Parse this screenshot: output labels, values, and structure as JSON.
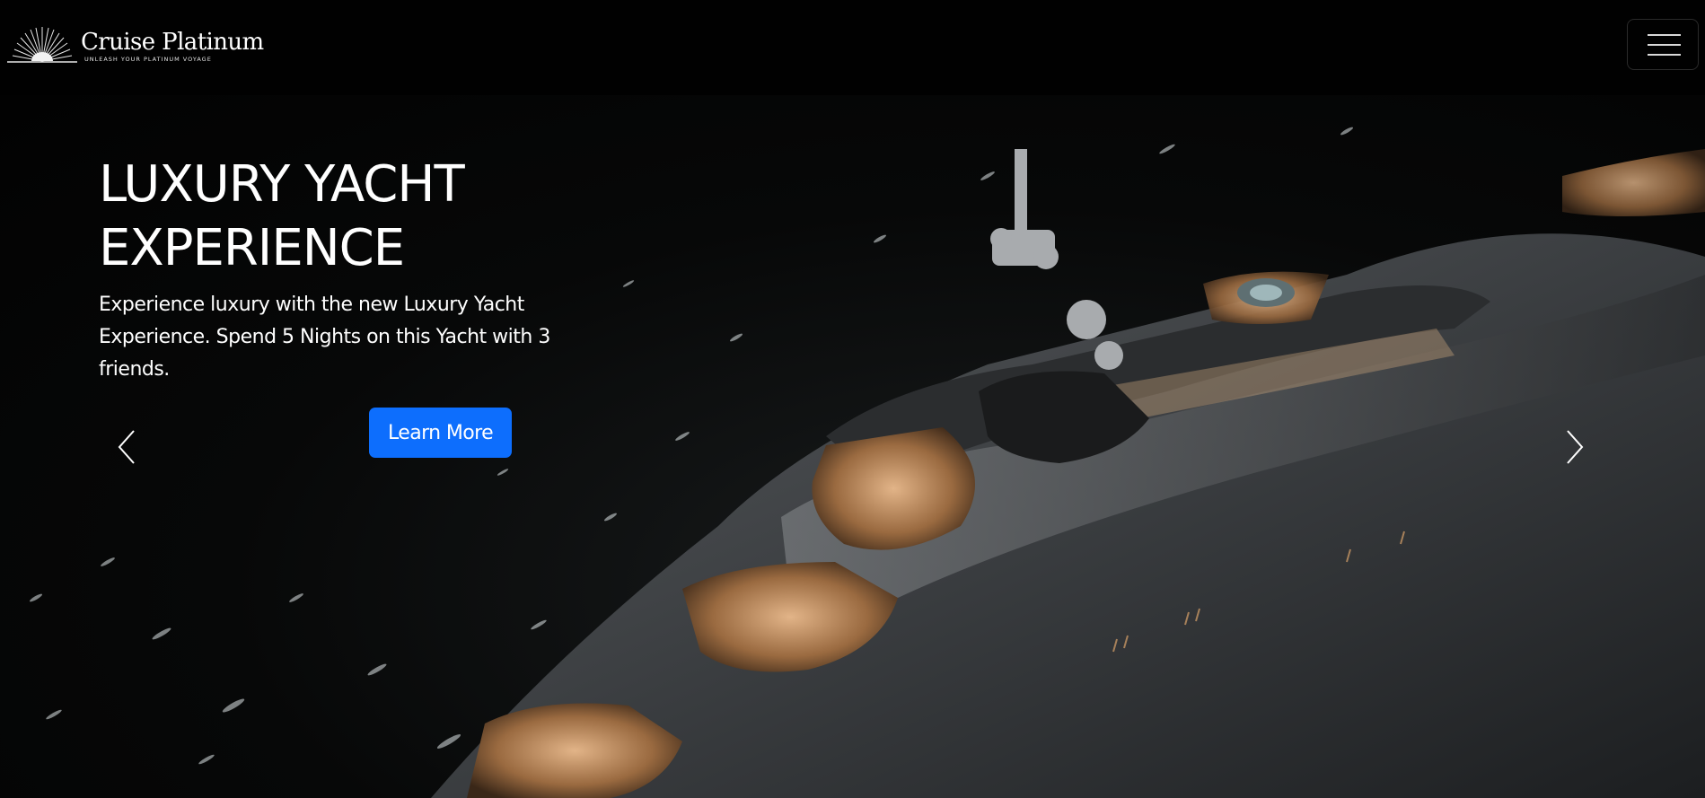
{
  "brand": {
    "name": "Cruise Platinum",
    "tagline": "UNLEASH YOUR PLATINUM VOYAGE",
    "logo_icon": "sunburst-logo-icon"
  },
  "nav": {
    "toggler_icon": "hamburger-menu-icon"
  },
  "carousel": {
    "slide": {
      "title": "LUXURY YACHT EXPERIENCE",
      "description": "Experience luxury with the new Luxury Yacht Experience. Spend 5 Nights on this Yacht with 3 friends.",
      "button_label": "Learn More"
    },
    "prev_icon": "chevron-left-icon",
    "next_icon": "chevron-right-icon"
  },
  "colors": {
    "accent": "#0d6efd",
    "background": "#000000",
    "text": "#ffffff"
  }
}
